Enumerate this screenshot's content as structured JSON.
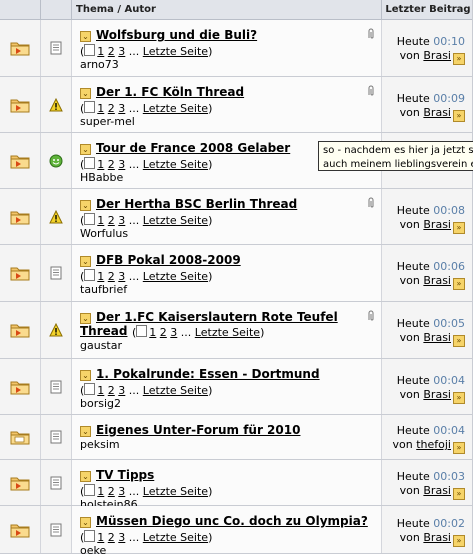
{
  "header": {
    "col_topic": "Thema / Autor",
    "col_last": "Letzter Beitrag"
  },
  "tooltip": {
    "line1": "so - nachdem es hier ja jetzt so",
    "line2": "auch meinem lieblingsverein ein"
  },
  "rows": [
    {
      "title": "Wolfsburg und die Buli?",
      "pages": [
        "1",
        "2",
        "3"
      ],
      "ellipsis": "...",
      "last_page_label": "Letzte Seite",
      "author": "arno73",
      "time_label": "Heute",
      "time": "00:10",
      "by_label": "von",
      "by_user": "Brasi",
      "has_paperclip": true,
      "icon": "folder-hot-icon",
      "post_icon": "post-page-icon"
    },
    {
      "title": "Der 1. FC Köln Thread",
      "pages": [
        "1",
        "2",
        "3"
      ],
      "ellipsis": "...",
      "last_page_label": "Letzte Seite",
      "author": "super-mel",
      "time_label": "Heute",
      "time": "00:09",
      "by_label": "von",
      "by_user": "Brasi",
      "has_paperclip": true,
      "icon": "folder-hot-icon",
      "post_icon": "warning-icon"
    },
    {
      "title": "Tour de France 2008 Gelaber",
      "pages": [
        "1",
        "2",
        "3"
      ],
      "ellipsis": "...",
      "last_page_label": "Letzte Seite",
      "author": "HBabbe",
      "time_label": "",
      "time": "",
      "by_label": "",
      "by_user": "",
      "has_paperclip": false,
      "icon": "folder-hot-icon",
      "post_icon": "smiley-icon"
    },
    {
      "title": "Der Hertha BSC Berlin Thread",
      "pages": [
        "1",
        "2",
        "3"
      ],
      "ellipsis": "...",
      "last_page_label": "Letzte Seite",
      "author": "Worfulus",
      "time_label": "Heute",
      "time": "00:08",
      "by_label": "von",
      "by_user": "Brasi",
      "has_paperclip": true,
      "icon": "folder-hot-icon",
      "post_icon": "warning-icon"
    },
    {
      "title": "DFB Pokal 2008-2009",
      "pages": [
        "1",
        "2",
        "3"
      ],
      "ellipsis": "...",
      "last_page_label": "Letzte Seite",
      "author": "taufbrief",
      "time_label": "Heute",
      "time": "00:06",
      "by_label": "von",
      "by_user": "Brasi",
      "has_paperclip": false,
      "icon": "folder-hot-icon",
      "post_icon": "post-page-icon"
    },
    {
      "title": "Der 1.FC Kaiserslautern Rote Teufel",
      "title2": "Thread",
      "pages": [
        "1",
        "2",
        "3"
      ],
      "ellipsis": "...",
      "last_page_label": "Letzte Seite",
      "author": "gaustar",
      "time_label": "Heute",
      "time": "00:05",
      "by_label": "von",
      "by_user": "Brasi",
      "has_paperclip": true,
      "icon": "folder-hot-icon",
      "post_icon": "warning-icon"
    },
    {
      "title": "1. Pokalrunde: Essen - Dortmund",
      "pages": [
        "1",
        "2",
        "3"
      ],
      "ellipsis": "...",
      "last_page_label": "Letzte Seite",
      "author": "borsig2",
      "time_label": "Heute",
      "time": "00:04",
      "by_label": "von",
      "by_user": "Brasi",
      "has_paperclip": false,
      "icon": "folder-hot-icon",
      "post_icon": "post-page-icon"
    },
    {
      "title": "Eigenes Unter-Forum für 2010",
      "author": "peksim",
      "time_label": "Heute",
      "time": "00:04",
      "by_label": "von",
      "by_user": "thefoji",
      "has_paperclip": false,
      "icon": "folder-new-icon",
      "post_icon": "post-page-icon"
    },
    {
      "title": "TV Tipps",
      "pages": [
        "1",
        "2",
        "3"
      ],
      "ellipsis": "...",
      "last_page_label": "Letzte Seite",
      "author": "holstein86",
      "time_label": "Heute",
      "time": "00:03",
      "by_label": "von",
      "by_user": "Brasi",
      "has_paperclip": false,
      "icon": "folder-hot-icon",
      "post_icon": "post-page-icon"
    },
    {
      "title": "Müssen Diego unc Co. doch zu Olympia?",
      "pages": [
        "1",
        "2",
        "3"
      ],
      "ellipsis": "...",
      "last_page_label": "Letzte Seite",
      "author": "oeke",
      "time_label": "Heute",
      "time": "00:02",
      "by_label": "von",
      "by_user": "Brasi",
      "has_paperclip": false,
      "icon": "folder-hot-icon",
      "post_icon": "post-page-icon"
    }
  ]
}
